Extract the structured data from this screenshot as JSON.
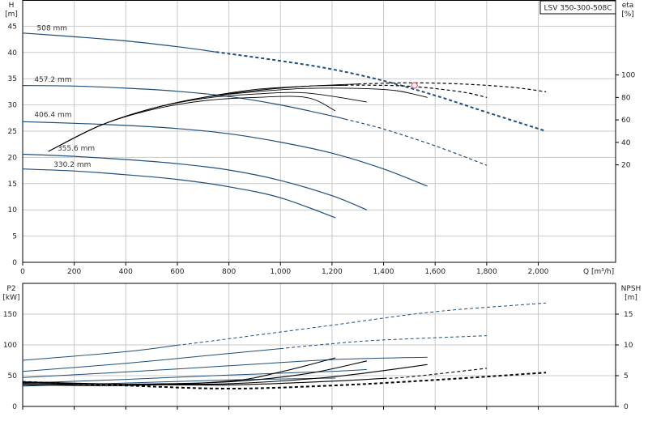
{
  "model_label": "LSV 350-300-508C",
  "colors": {
    "blue": "#1f4e79",
    "black": "#000000",
    "grid": "#c8c8c8",
    "axis": "#000000",
    "point": "#e06070"
  },
  "chart_data": [
    {
      "type": "line",
      "panel": "top",
      "ylabel_left": [
        "H",
        "[m]"
      ],
      "ylabel_right": [
        "eta",
        "[%]"
      ],
      "xlabel": "Q [m³/h]",
      "xlim": [
        0,
        2300
      ],
      "ylim_left": [
        0,
        50
      ],
      "ylim_right": [
        -66.7,
        166.7
      ],
      "x_ticks": [
        0,
        200,
        400,
        600,
        800,
        1000,
        1200,
        1400,
        1600,
        1800,
        2000
      ],
      "x_tick_labels": [
        "0",
        "200",
        "400",
        "600",
        "800",
        "1,000",
        "1,200",
        "1,400",
        "1,600",
        "1,800",
        "2,000"
      ],
      "y_ticks_left": [
        0,
        5,
        10,
        15,
        20,
        25,
        30,
        35,
        40,
        45
      ],
      "y_ticks_right": [
        20,
        40,
        60,
        80,
        100
      ],
      "grid": true,
      "head_curves": [
        {
          "name": "508 mm",
          "label_at": [
            55,
            44.2
          ],
          "x": [
            0,
            200,
            400,
            600,
            750,
            1000,
            1200,
            1400,
            1600,
            1800,
            2030
          ],
          "y": [
            43.7,
            43.0,
            42.2,
            41.1,
            40.1,
            38.4,
            36.8,
            34.6,
            31.8,
            28.6,
            25.0
          ],
          "solid_until": 750
        },
        {
          "name": "457.2 mm",
          "label_at": [
            45,
            34.4
          ],
          "x": [
            0,
            200,
            400,
            600,
            800,
            1000,
            1200,
            1250,
            1400,
            1600,
            1800
          ],
          "y": [
            33.7,
            33.6,
            33.2,
            32.6,
            31.6,
            30.0,
            27.9,
            27.3,
            25.4,
            22.2,
            18.5
          ],
          "solid_until": 1250
        },
        {
          "name": "406.4 mm",
          "label_at": [
            45,
            27.7
          ],
          "x": [
            0,
            200,
            400,
            600,
            800,
            1000,
            1200,
            1400,
            1570
          ],
          "y": [
            26.8,
            26.5,
            26.1,
            25.5,
            24.5,
            22.9,
            20.8,
            17.8,
            14.5
          ],
          "solid_until": 1570
        },
        {
          "name": "355.6 mm",
          "label_at": [
            135,
            21.3
          ],
          "x": [
            0,
            200,
            400,
            600,
            800,
            1000,
            1200,
            1335
          ],
          "y": [
            20.6,
            20.2,
            19.6,
            18.8,
            17.6,
            15.6,
            12.7,
            10.0
          ],
          "solid_until": 1335
        },
        {
          "name": "330.2 mm",
          "label_at": [
            120,
            18.2
          ],
          "x": [
            0,
            200,
            400,
            600,
            800,
            1000,
            1213
          ],
          "y": [
            17.8,
            17.4,
            16.7,
            15.8,
            14.4,
            12.3,
            8.5
          ],
          "solid_until": 1213
        }
      ],
      "eta_curves": [
        {
          "x": [
            100,
            300,
            500,
            700,
            900,
            1100,
            1300,
            1500,
            1700,
            1900,
            2030
          ],
          "y": [
            32,
            55,
            70,
            80,
            87,
            90,
            92,
            93,
            92,
            89,
            85
          ],
          "solid_until": 1300
        },
        {
          "x": [
            100,
            300,
            500,
            700,
            900,
            1100,
            1300,
            1500,
            1700,
            1800
          ],
          "y": [
            32,
            55,
            70,
            80,
            86,
            90,
            91,
            90,
            85,
            80
          ],
          "solid_until": 1250
        },
        {
          "x": [
            100,
            300,
            500,
            700,
            900,
            1100,
            1300,
            1450,
            1570
          ],
          "y": [
            32,
            55,
            70,
            80,
            85,
            88,
            88,
            86,
            80
          ],
          "solid_until": 1570
        },
        {
          "x": [
            100,
            300,
            500,
            700,
            900,
            1100,
            1335
          ],
          "y": [
            32,
            55,
            70,
            79,
            83,
            84,
            76
          ],
          "solid_until": 1335
        },
        {
          "x": [
            100,
            300,
            500,
            700,
            900,
            1100,
            1213
          ],
          "y": [
            32,
            55,
            69,
            77,
            80,
            80,
            68
          ],
          "solid_until": 1213
        }
      ],
      "duty_point": {
        "x": 1520,
        "y": 33.7
      }
    },
    {
      "type": "line",
      "panel": "bottom",
      "ylabel_left": [
        "P2",
        "[kW]"
      ],
      "ylabel_right": [
        "NPSH",
        "[m]"
      ],
      "xlim": [
        0,
        2300
      ],
      "ylim_left": [
        0,
        200
      ],
      "ylim_right": [
        0,
        20
      ],
      "y_ticks_left": [
        0,
        50,
        100,
        150
      ],
      "y_ticks_right": [
        0,
        5,
        10,
        15
      ],
      "grid": true,
      "power_curves": [
        {
          "x": [
            0,
            400,
            800,
            1200,
            1600,
            2030
          ],
          "y": [
            75,
            89,
            110,
            132,
            154,
            168
          ],
          "solid_until": 600
        },
        {
          "x": [
            0,
            400,
            800,
            1200,
            1400,
            1800
          ],
          "y": [
            57,
            70,
            86,
            102,
            108,
            115
          ],
          "solid_until": 1000
        },
        {
          "x": [
            0,
            400,
            800,
            1200,
            1570
          ],
          "y": [
            47,
            56,
            66,
            76,
            80
          ],
          "solid_until": 1570
        },
        {
          "x": [
            0,
            400,
            800,
            1200,
            1335
          ],
          "y": [
            38,
            44,
            51,
            57,
            60
          ],
          "solid_until": 1335
        },
        {
          "x": [
            0,
            400,
            800,
            1213
          ],
          "y": [
            33,
            38,
            43,
            46
          ],
          "solid_until": 1213
        }
      ],
      "npsh_curves": [
        {
          "x": [
            0,
            400,
            800,
            1200,
            1600,
            2030
          ],
          "y": [
            4.0,
            3.4,
            2.9,
            3.4,
            4.3,
            5.5
          ],
          "solid_until": 0
        },
        {
          "x": [
            0,
            400,
            800,
            1200,
            1500,
            1800
          ],
          "y": [
            4.0,
            3.6,
            3.5,
            4.1,
            4.8,
            6.2
          ],
          "solid_until": 1400
        },
        {
          "x": [
            0,
            400,
            800,
            1200,
            1570
          ],
          "y": [
            3.9,
            3.6,
            3.7,
            4.8,
            6.8
          ],
          "solid_until": 1570
        },
        {
          "x": [
            0,
            400,
            800,
            1100,
            1335
          ],
          "y": [
            3.7,
            3.6,
            4.0,
            5.3,
            7.4
          ],
          "solid_until": 1335
        },
        {
          "x": [
            0,
            400,
            800,
            1000,
            1213
          ],
          "y": [
            3.5,
            3.4,
            4.1,
            5.6,
            7.9
          ],
          "solid_until": 1213
        }
      ]
    }
  ]
}
